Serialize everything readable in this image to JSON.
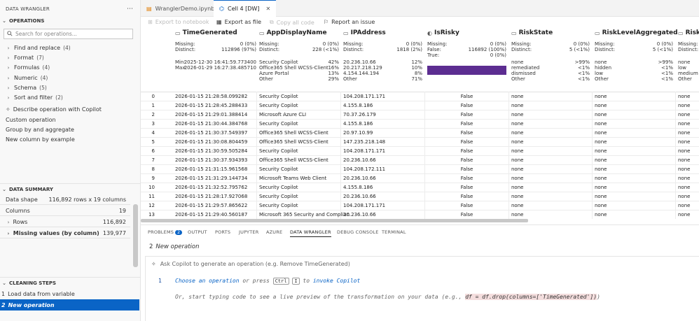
{
  "sidebar": {
    "header": "DATA WRANGLER",
    "ops_section": "OPERATIONS",
    "search_placeholder": "Search for operations...",
    "operations": [
      {
        "label": "Find and replace",
        "count": "(4)"
      },
      {
        "label": "Format",
        "count": "(7)"
      },
      {
        "label": "Formulas",
        "count": "(4)"
      },
      {
        "label": "Numeric",
        "count": "(4)"
      },
      {
        "label": "Schema",
        "count": "(5)"
      },
      {
        "label": "Sort and filter",
        "count": "(2)"
      }
    ],
    "describe": "Describe operation with Copilot",
    "custom": "Custom operation",
    "groupby": "Group by and aggregate",
    "newcol": "New column by example",
    "summary_section": "DATA SUMMARY",
    "summary": {
      "shape_label": "Data shape",
      "shape_value": "116,892 rows x 19 columns",
      "cols_label": "Columns",
      "cols_value": "19",
      "rows_label": "Rows",
      "rows_value": "116,892",
      "missing_label": "Missing values (by column)",
      "missing_value": "139,977"
    },
    "steps_section": "CLEANING STEPS",
    "steps": [
      {
        "num": "1",
        "label": "Load data from variable"
      },
      {
        "num": "2",
        "label": "New operation"
      }
    ]
  },
  "tabs": [
    {
      "label": "WranglerDemo.ipynb"
    },
    {
      "label": "Cell 4 [DW]"
    }
  ],
  "toolbar": {
    "export_nb": "Export to notebook",
    "export_file": "Export as file",
    "copy_code": "Copy all code",
    "report": "Report an issue"
  },
  "columns": {
    "c1": {
      "name": "TimeGenerated",
      "missing": "Missing:",
      "missing_v": "0 (0%)",
      "distinct": "Distinct:",
      "distinct_v": "112896 (97%)",
      "min": "Min:",
      "min_v": "2025-12-30 16:41:59.773400",
      "max": "Max:",
      "max_v": "2026-01-29 16:27:38.485710"
    },
    "c2": {
      "name": "AppDisplayName",
      "missing": "Missing:",
      "missing_v": "0 (0%)",
      "distinct": "Distinct:",
      "distinct_v": "228 (<1%)",
      "top": [
        [
          "Security Copilot",
          "42%"
        ],
        [
          "Office365 Shell WCSS-Client",
          "16%"
        ],
        [
          "Azure Portal",
          "13%"
        ],
        [
          "Other",
          "29%"
        ]
      ]
    },
    "c3": {
      "name": "IPAddress",
      "missing": "Missing:",
      "missing_v": "0 (0%)",
      "distinct": "Distinct:",
      "distinct_v": "1818 (2%)",
      "top": [
        [
          "20.236.10.66",
          "12%"
        ],
        [
          "20.217.218.129",
          "10%"
        ],
        [
          "4.154.144.194",
          "8%"
        ],
        [
          "Other",
          "71%"
        ]
      ]
    },
    "c4": {
      "name": "IsRisky",
      "missing": "Missing:",
      "missing_v": "0 (0%)",
      "false": "False:",
      "false_v": "116892 (100%)",
      "true": "True:",
      "true_v": "0 (0%)",
      "false_fraction": 1.0
    },
    "c5": {
      "name": "RiskState",
      "missing": "Missing:",
      "missing_v": "0 (0%)",
      "distinct": "Distinct:",
      "distinct_v": "5 (<1%)",
      "top": [
        [
          "none",
          ">99%"
        ],
        [
          "remediated",
          "<1%"
        ],
        [
          "dismissed",
          "<1%"
        ],
        [
          "Other",
          "<1%"
        ]
      ]
    },
    "c6": {
      "name": "RiskLevelAggregated",
      "missing": "Missing:",
      "missing_v": "0 (0%)",
      "distinct": "Distinct:",
      "distinct_v": "5 (<1%)",
      "top": [
        [
          "none",
          ">99%"
        ],
        [
          "hidden",
          "<1%"
        ],
        [
          "low",
          "<1%"
        ],
        [
          "Other",
          "<1%"
        ]
      ]
    },
    "c7": {
      "name": "RiskL",
      "missing": "Missing:",
      "distinct": "Distinct:",
      "top": [
        [
          "none"
        ],
        [
          "low"
        ],
        [
          "medium"
        ],
        [
          "Other"
        ]
      ]
    }
  },
  "rows": [
    [
      "0",
      "2026-01-15 21:28:58.099282",
      "Security Copilot",
      "104.208.171.171",
      "False",
      "none",
      "none",
      "none"
    ],
    [
      "1",
      "2026-01-15 21:28:45.288433",
      "Security Copilot",
      "4.155.8.186",
      "False",
      "none",
      "none",
      "none"
    ],
    [
      "2",
      "2026-01-15 21:29:01.388414",
      "Microsoft Azure CLI",
      "70.37.26.179",
      "False",
      "none",
      "none",
      "none"
    ],
    [
      "3",
      "2026-01-15 21:30:44.384768",
      "Security Copilot",
      "4.155.8.186",
      "False",
      "none",
      "none",
      "none"
    ],
    [
      "4",
      "2026-01-15 21:30:37.549397",
      "Office365 Shell WCSS-Client",
      "20.97.10.99",
      "False",
      "none",
      "none",
      "none"
    ],
    [
      "5",
      "2026-01-15 21:30:08.804459",
      "Office365 Shell WCSS-Client",
      "147.235.218.148",
      "False",
      "none",
      "none",
      "none"
    ],
    [
      "6",
      "2026-01-15 21:30:59.505284",
      "Security Copilot",
      "104.208.171.171",
      "False",
      "none",
      "none",
      "none"
    ],
    [
      "7",
      "2026-01-15 21:30:37.934393",
      "Office365 Shell WCSS-Client",
      "20.236.10.66",
      "False",
      "none",
      "none",
      "none"
    ],
    [
      "8",
      "2026-01-15 21:31:15.961568",
      "Security Copilot",
      "104.208.172.111",
      "False",
      "none",
      "none",
      "none"
    ],
    [
      "9",
      "2026-01-15 21:31:29.144734",
      "Microsoft Teams Web Client",
      "20.236.10.66",
      "False",
      "none",
      "none",
      "none"
    ],
    [
      "10",
      "2026-01-15 21:32:52.795762",
      "Security Copilot",
      "4.155.8.186",
      "False",
      "none",
      "none",
      "none"
    ],
    [
      "11",
      "2026-01-15 21:28:17.927068",
      "Security Copilot",
      "20.236.10.66",
      "False",
      "none",
      "none",
      "none"
    ],
    [
      "12",
      "2026-01-15 21:29:57.865622",
      "Security Copilot",
      "104.208.171.171",
      "False",
      "none",
      "none",
      "none"
    ],
    [
      "13",
      "2026-01-15 21:29:40.560187",
      "Microsoft 365 Security and Complian",
      "20.236.10.66",
      "False",
      "none",
      "none",
      "none"
    ]
  ],
  "panel": {
    "tabs": [
      "PROBLEMS",
      "OUTPUT",
      "PORTS",
      "JUPYTER",
      "AZURE",
      "DATA WRANGLER",
      "DEBUG CONSOLE",
      "TERMINAL"
    ],
    "problems_count": "2",
    "op_num": "2",
    "op_title": "New operation",
    "copilot_placeholder": "Ask Copilot to generate an operation (e.g. Remove TimeGenerated)",
    "line_num": "1",
    "line1_a": "Choose an operation",
    "line1_b": " or press ",
    "kbd1": "Ctrl",
    "kbd2": "I",
    "line1_c": " to ",
    "line1_d": "invoke Copilot",
    "line2_a": "Or, start typing code to see a live preview of the transformation on your data (e.g., ",
    "line2_code": "df = df.drop(columns=['TimeGenerated'])",
    "line2_b": ")"
  },
  "colors": {
    "accent": "#0a64c6",
    "risky_bar": "#5c2d91"
  }
}
